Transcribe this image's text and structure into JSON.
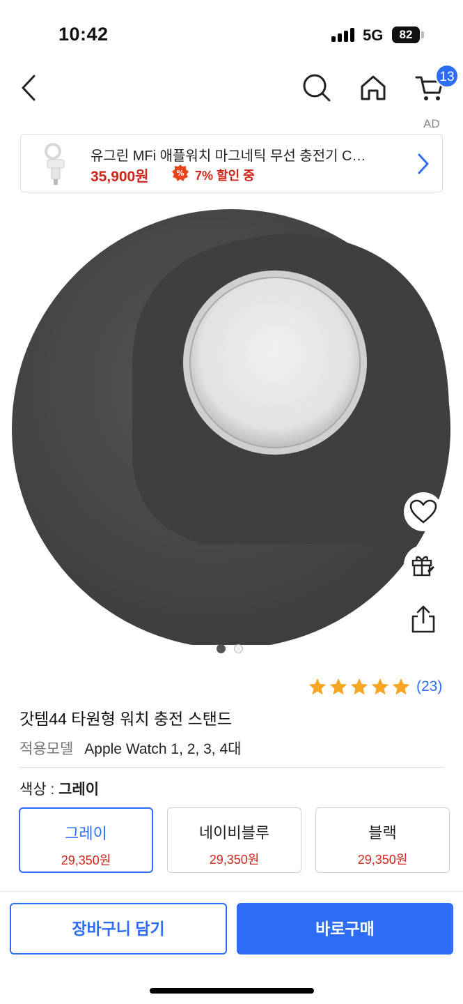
{
  "status_bar": {
    "time": "10:42",
    "network": "5G",
    "battery": "82"
  },
  "nav": {
    "back_icon": "chevron-left-icon",
    "search_icon": "search-icon",
    "home_icon": "home-icon",
    "cart_icon": "cart-icon",
    "cart_count": "13"
  },
  "ad": {
    "label": "AD",
    "title": "유그린 MFi 애플워치 마그네틱 무선 충전기 C…",
    "price": "35,900원",
    "discount": "7% 할인 중"
  },
  "product": {
    "image_dots": 2,
    "active_dot": 0,
    "rating": 5,
    "review_count": "(23)",
    "title": "갓템44 타원형 워치 충전 스탠드",
    "model_label": "적용모델",
    "model_value": "Apple Watch 1, 2, 3, 4대"
  },
  "options": {
    "color_label": "색상 : ",
    "selected_color": "그레이",
    "items": [
      {
        "name": "그레이",
        "price": "29,350원",
        "selected": true
      },
      {
        "name": "네이비블루",
        "price": "29,350원",
        "selected": false
      },
      {
        "name": "블랙",
        "price": "29,350원",
        "selected": false
      }
    ]
  },
  "actions": {
    "add_to_cart": "장바구니 담기",
    "buy_now": "바로구매"
  },
  "colors": {
    "accent": "#2d6df6",
    "price_red": "#d0261c",
    "product_dark": "#4a4a4a",
    "star": "#f5a623"
  }
}
